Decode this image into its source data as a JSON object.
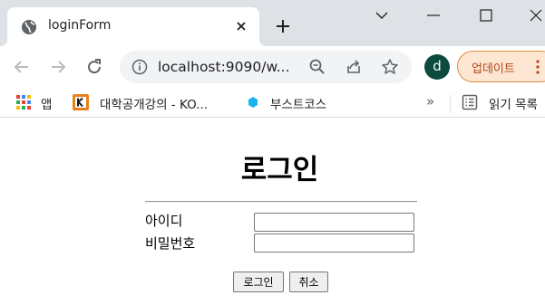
{
  "browser": {
    "tab": {
      "title": "loginForm",
      "favicon": "globe-icon"
    },
    "window_controls": [
      "chevron-down-icon",
      "minimize-icon",
      "maximize-icon",
      "close-icon"
    ],
    "address_bar": {
      "url": "localhost:9090/w...",
      "icons": [
        "info-icon",
        "zoom-icon",
        "share-icon",
        "star-icon"
      ]
    },
    "profile": {
      "initial": "d",
      "color": "#0b4a3d"
    },
    "update_button": {
      "label": "업데이트",
      "color": "#b3441d"
    }
  },
  "bookmarks": {
    "items": [
      {
        "label": "앱",
        "icon": "apps-grid-icon"
      },
      {
        "label": "대학공개강의 - KO...",
        "icon": "kocw-icon"
      },
      {
        "label": "부스트코스",
        "icon": "boostcourse-icon"
      }
    ],
    "more": "»",
    "reading_list": {
      "label": "읽기 목록",
      "icon": "reading-list-icon"
    }
  },
  "page": {
    "title": "로그인",
    "form": {
      "id_label": "아이디",
      "id_value": "",
      "pw_label": "비밀번호",
      "pw_value": "",
      "login_button": "로그인",
      "cancel_button": "취소"
    }
  }
}
